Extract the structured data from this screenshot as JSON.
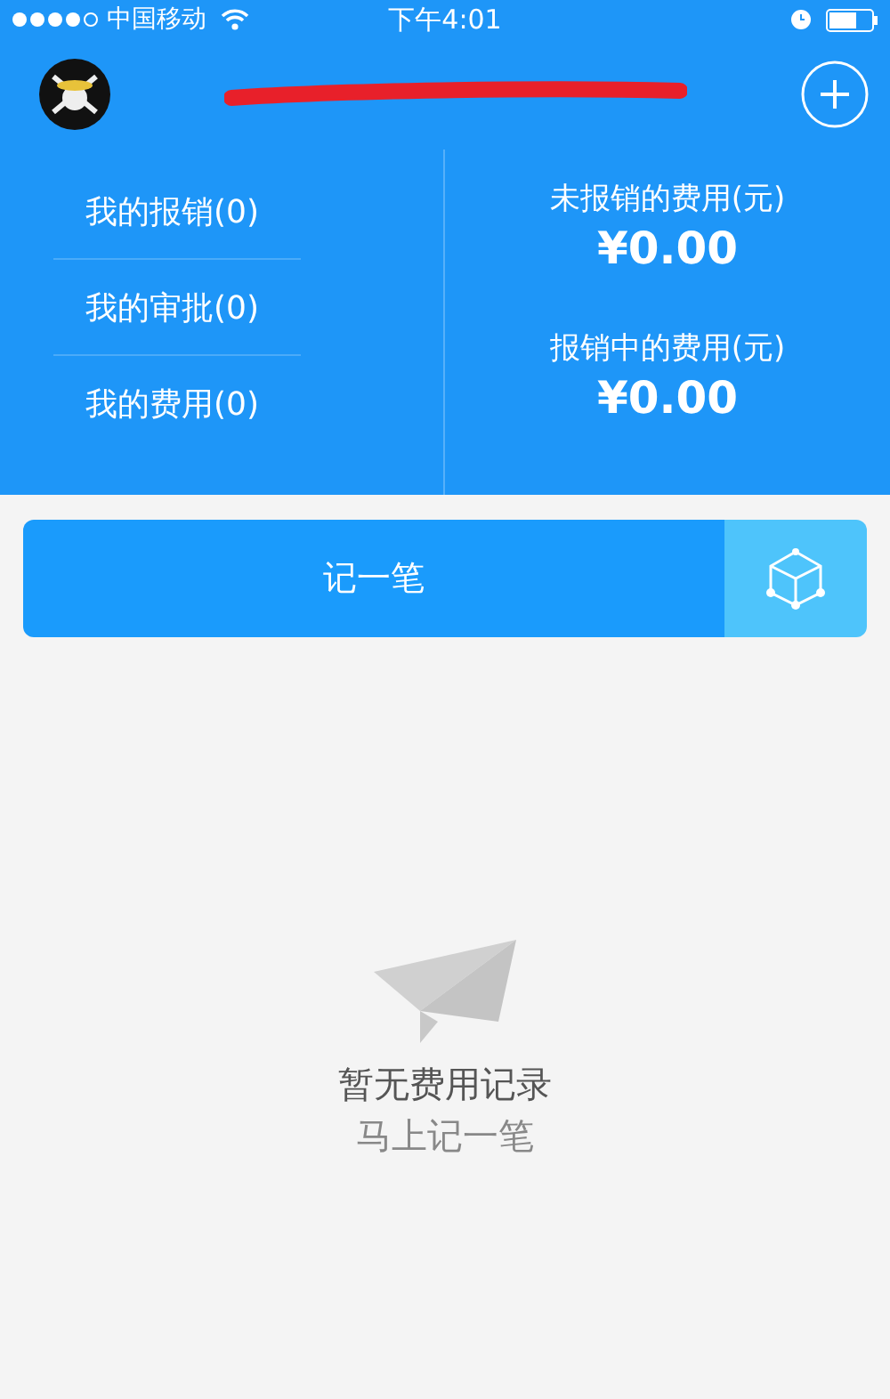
{
  "status_bar": {
    "carrier": "中国移动",
    "time": "下午4:01"
  },
  "header": {
    "redacted_title": true
  },
  "menu": [
    {
      "label": "我的报销(0)"
    },
    {
      "label": "我的审批(0)"
    },
    {
      "label": "我的费用(0)"
    }
  ],
  "totals": [
    {
      "label": "未报销的费用(元)",
      "amount": "¥0.00"
    },
    {
      "label": "报销中的费用(元)",
      "amount": "¥0.00"
    }
  ],
  "record_button": {
    "label": "记一笔"
  },
  "empty_state": {
    "title": "暂无费用记录",
    "subtitle": "马上记一笔"
  }
}
